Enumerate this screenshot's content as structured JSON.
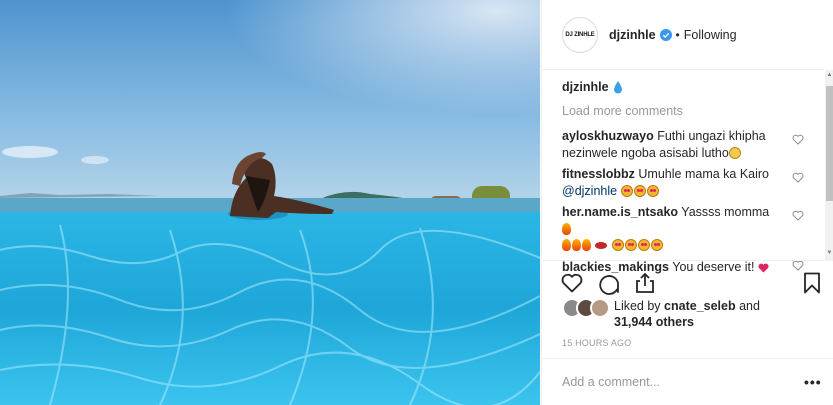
{
  "post": {
    "author": "djzinhle",
    "avatar_text": "DJ ZINHLE",
    "follow_status": "Following",
    "separator": "•"
  },
  "caption": {
    "user": "djzinhle"
  },
  "load_more": "Load more comments",
  "comments": [
    {
      "user": "ayloskhuzwayo",
      "text": "Futhi ungazi khipha nezinwele ngoba asisabi lutho"
    },
    {
      "user": "fitnesslobbz",
      "text": "Umuhle mama ka Kairo",
      "mention": "@djzinhle"
    },
    {
      "user": "her.name.is_ntsako",
      "text": "Yassss momma"
    },
    {
      "user": "blackies_makings",
      "text": "You deserve it!"
    }
  ],
  "likes": {
    "prefix": "Liked by",
    "user": "cnate_seleb",
    "joiner": "and",
    "others": "31,944 others"
  },
  "timestamp": "15 HOURS AGO",
  "add_comment_placeholder": "Add a comment...",
  "more_label": "•••",
  "icons": {
    "like": "heart-icon",
    "comment": "comment-icon",
    "share": "share-icon",
    "save": "bookmark-icon",
    "verified": "verified-badge-icon"
  },
  "colors": {
    "verified": "#3897f0",
    "link": "#003569",
    "muted": "#999999",
    "text": "#262626"
  }
}
